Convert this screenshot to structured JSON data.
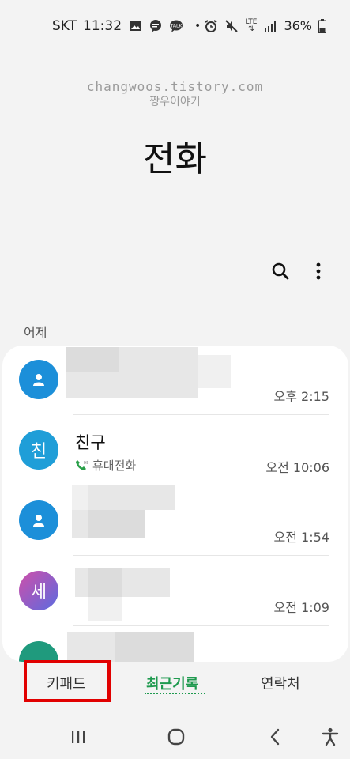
{
  "status_bar": {
    "carrier": "SKT",
    "time": "11:32",
    "network": "LTE",
    "battery": "36%"
  },
  "watermark": {
    "line1": "changwoos.tistory.com",
    "line2": "짱우이야기"
  },
  "page_title": "전화",
  "toolbar": {
    "search_icon": "search-icon",
    "more_icon": "more-vert-icon"
  },
  "section_label": "어제",
  "calls": [
    {
      "name": "",
      "avatar": "person",
      "time": "오후 2:15"
    },
    {
      "name": "친구",
      "avatar": "친",
      "sub": "휴대전화",
      "time": "오전 10:06"
    },
    {
      "name": "",
      "avatar": "person",
      "time": "오전 1:54"
    },
    {
      "name": "",
      "avatar": "세",
      "time": "오전 1:09"
    }
  ],
  "tabs": {
    "keypad": "키패드",
    "recents": "최근기록",
    "contacts": "연락처",
    "active": "recents"
  },
  "colors": {
    "accent": "#1f9a4f",
    "highlight": "#e10000",
    "avatar_blue": "#1c8fd9"
  }
}
